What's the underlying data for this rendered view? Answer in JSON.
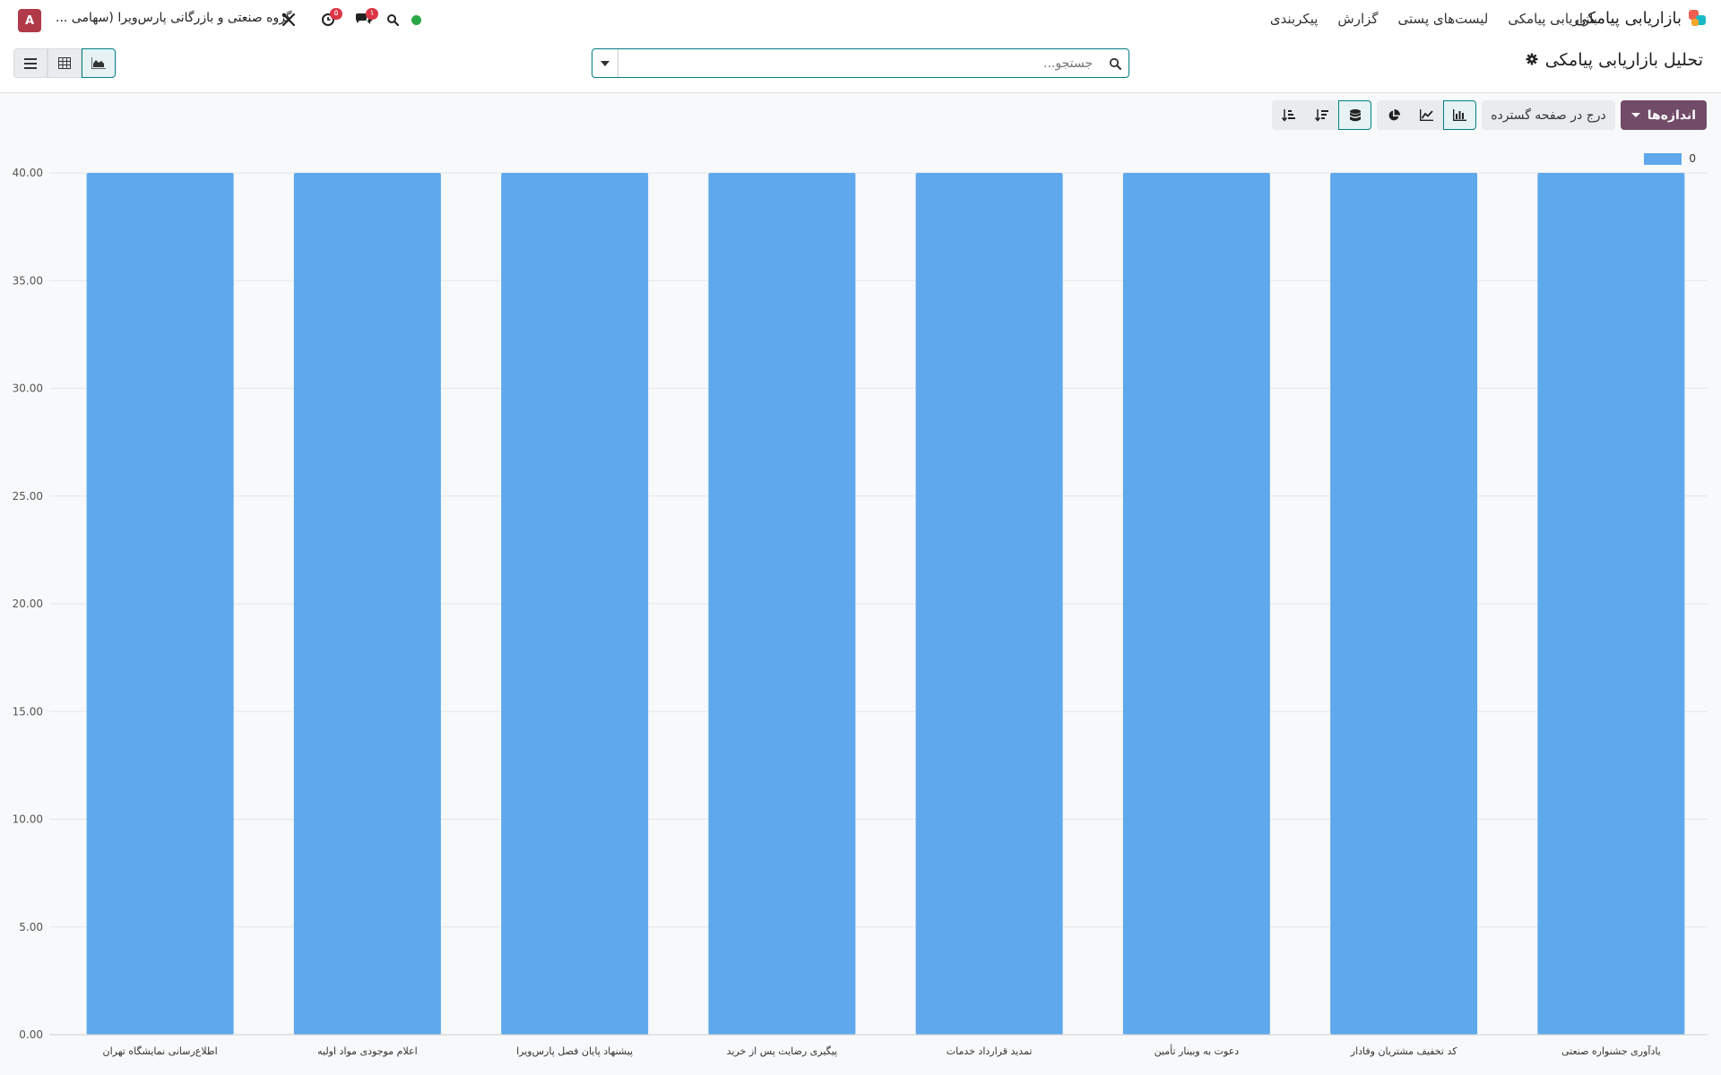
{
  "navbar": {
    "app_title": "بازاریابی پیامکی",
    "menu": [
      "بازاریابی پیامکی",
      "لیست‌های پستی",
      "گزارش",
      "پیکربندی"
    ],
    "company": "گروه صنعتی و بازرگانی پارس‌ویرا (سهامی ...",
    "avatar_letter": "A",
    "activity_badge": "۵",
    "messages_badge": "۱",
    "icons": [
      "tools-icon",
      "clock-icon",
      "chat-icon",
      "search-icon",
      "presence-dot"
    ]
  },
  "control_panel": {
    "breadcrumb_title": "تحلیل بازاریابی پیامکی",
    "search_placeholder": "جستجو...",
    "views": [
      "graph-view",
      "pivot-view",
      "list-view"
    ],
    "active_view": "graph-view"
  },
  "toolbar": {
    "measures_label": "اندازه‌ها",
    "insert_label": "درج در صفحه گسترده",
    "chart_types": [
      "bar-chart",
      "line-chart",
      "pie-chart"
    ],
    "active_chart_type": "bar-chart",
    "options": [
      "stacked",
      "sort-descending",
      "sort-ascending"
    ],
    "active_option": "stacked"
  },
  "colors": {
    "accent": "#714b67",
    "teal": "#017e84",
    "bar": "#5fa8ec",
    "presence": "#28a745",
    "badge": "#dc3545"
  },
  "chart_data": {
    "type": "bar",
    "categories": [
      "یادآوری جشنواره صنعتی",
      "کد تخفیف مشتریان وفادار",
      "دعوت به وبینار تأمین",
      "تمدید قرارداد خدمات",
      "پیگیری رضایت پس از خرید",
      "پیشنهاد پایان فصل پارس‌ویرا",
      "اعلام موجودی مواد اولیه",
      "اطلاع‌رسانی نمایشگاه تهران"
    ],
    "series": [
      {
        "name": "0",
        "values": [
          40,
          40,
          40,
          40,
          40,
          40,
          40,
          40
        ]
      }
    ],
    "ylim": [
      0,
      40
    ],
    "yticks": [
      "0.00",
      "5.00",
      "10.00",
      "15.00",
      "20.00",
      "25.00",
      "30.00",
      "35.00",
      "40.00"
    ],
    "category_order": "right-to-left",
    "grid": true,
    "legend_position": "top-right"
  }
}
